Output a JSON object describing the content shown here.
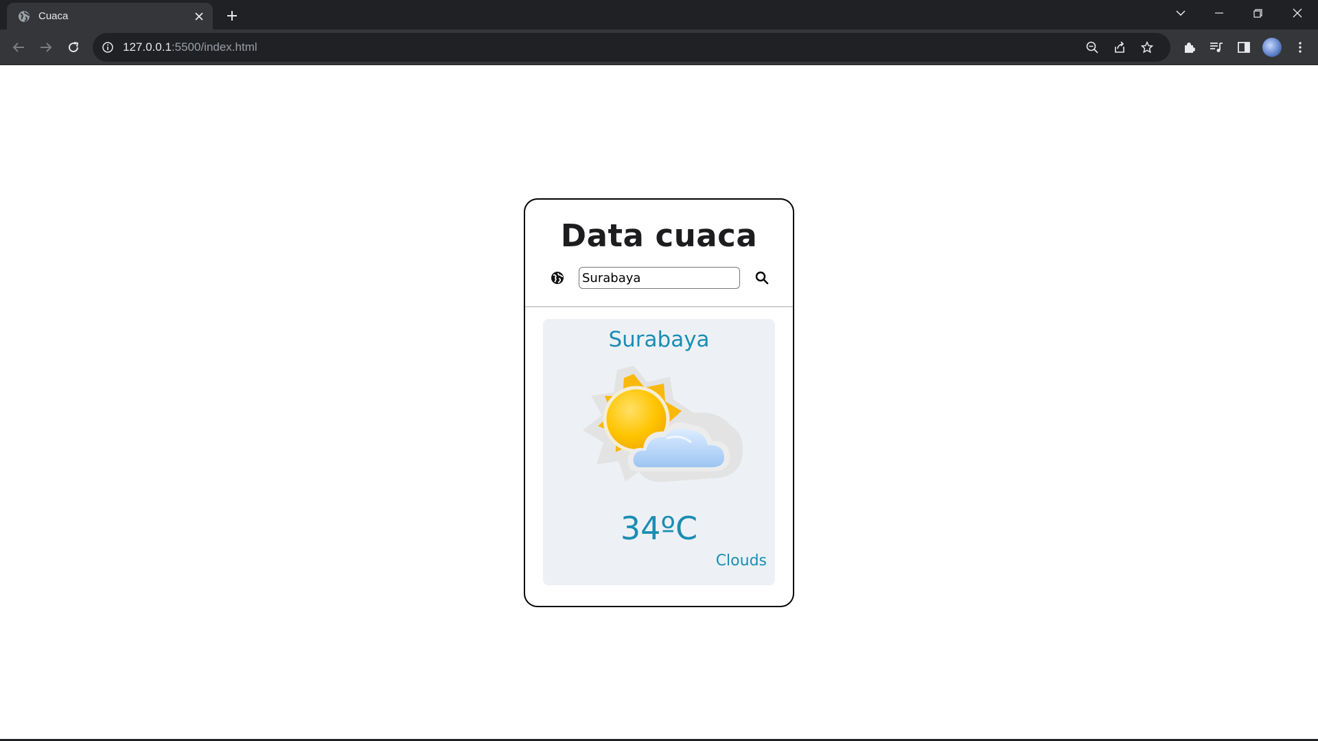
{
  "browser": {
    "tab": {
      "title": "Cuaca",
      "favicon": "globe-icon"
    },
    "address_bar": {
      "host": "127.0.0.1",
      "path": ":5500/index.html"
    },
    "icons": [
      "back-icon",
      "forward-icon",
      "reload-icon",
      "info-icon",
      "zoom-out-icon",
      "share-icon",
      "star-icon",
      "extensions-icon",
      "media-icon",
      "side-panel-icon",
      "profile-avatar",
      "menu-icon",
      "tab-search-icon",
      "minimize-icon",
      "restore-icon",
      "close-icon"
    ]
  },
  "app": {
    "title": "Data cuaca",
    "search": {
      "value": "Surabaya"
    },
    "result": {
      "city": "Surabaya",
      "temperature": "34ºC",
      "condition": "Clouds",
      "icon": "partly-cloudy-icon"
    },
    "colors": {
      "accent": "#1a8db3",
      "panel": "#edf1f5",
      "border": "#000000"
    }
  }
}
